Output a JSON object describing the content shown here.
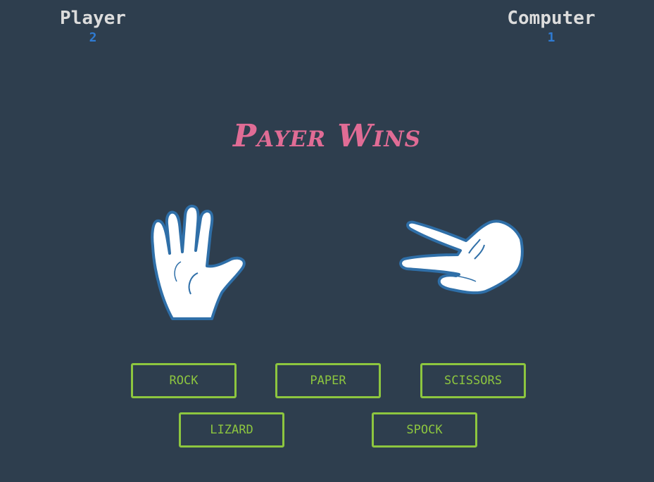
{
  "scoreboard": {
    "player": {
      "label": "Player",
      "score": "2"
    },
    "computer": {
      "label": "Computer",
      "score": "1"
    }
  },
  "result": {
    "text": "Payer Wins"
  },
  "hands": {
    "player_choice": "spock-hand-icon",
    "computer_choice": "scissors-hand-icon"
  },
  "buttons": {
    "rock": "ROCK",
    "paper": "PAPER",
    "scissors": "SCISSORS",
    "lizard": "LIZARD",
    "spock": "SPOCK"
  },
  "colors": {
    "background": "#2e3e4e",
    "accent_green": "#8dc63f",
    "result_pink": "#e06c95",
    "score_blue": "#2f7bd3",
    "label_gray": "#dcdcdc"
  }
}
